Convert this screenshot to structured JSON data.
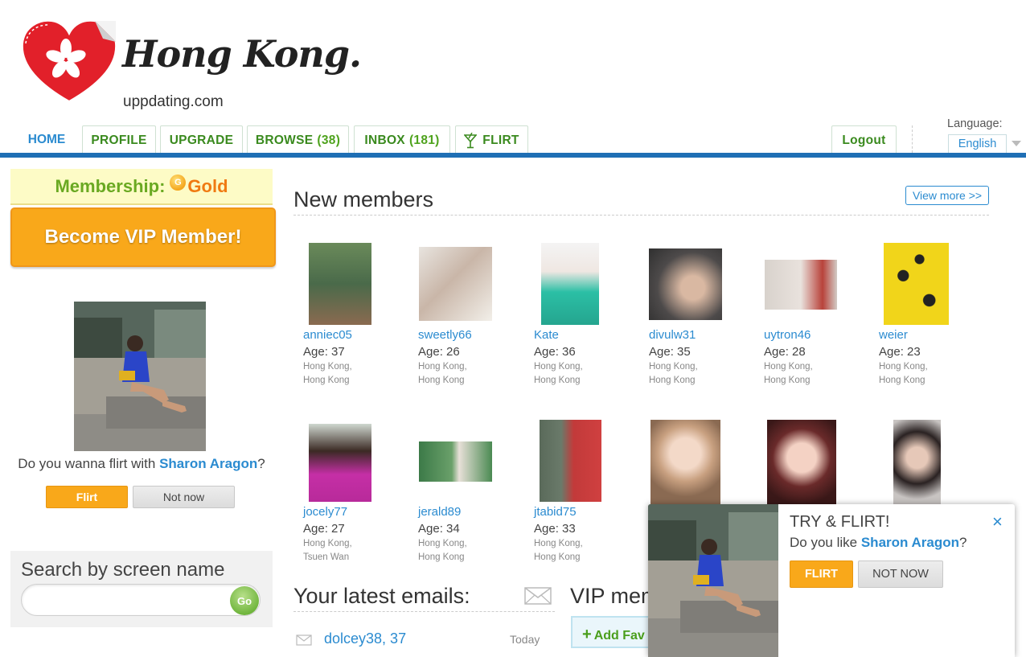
{
  "logo": {
    "title": "Hong Kong.",
    "domain": "uppdating.com",
    "heart_color": "#e2202a"
  },
  "nav": {
    "home": "HOME",
    "tabs": [
      {
        "label": "PROFILE",
        "count": ""
      },
      {
        "label": "UPGRADE",
        "count": ""
      },
      {
        "label": "BROWSE",
        "count": "(38)"
      },
      {
        "label": "INBOX",
        "count": "(181)"
      },
      {
        "label": "FLIRT",
        "count": "",
        "icon": "cocktail-icon"
      }
    ],
    "logout": "Logout",
    "language_label": "Language:",
    "language_value": "English",
    "accent": "#1f6fb5"
  },
  "sidebar": {
    "membership_label": "Membership:",
    "membership_level": "Gold",
    "vip_button": "Become VIP Member!",
    "flirt_prompt_pre": "Do you wanna flirt with",
    "flirt_name": "Sharon Aragon",
    "flirt_prompt_post": "?",
    "flirt_button": "Flirt",
    "not_now_button": "Not now",
    "search_title": "Search by screen name",
    "search_value": "",
    "go_button": "Go"
  },
  "new_members": {
    "title": "New members",
    "view_more": "View more >>",
    "members": [
      {
        "name": "anniec05",
        "age": "Age: 37",
        "city": "Hong Kong,",
        "region": "Hong Kong"
      },
      {
        "name": "sweetly66",
        "age": "Age: 26",
        "city": "Hong Kong,",
        "region": "Hong Kong"
      },
      {
        "name": "Kate",
        "age": "Age: 36",
        "city": "Hong Kong,",
        "region": "Hong Kong"
      },
      {
        "name": "divulw31",
        "age": "Age: 35",
        "city": "Hong Kong,",
        "region": "Hong Kong"
      },
      {
        "name": "uytron46",
        "age": "Age: 28",
        "city": "Hong Kong,",
        "region": "Hong Kong"
      },
      {
        "name": "weier",
        "age": "Age: 23",
        "city": "Hong Kong,",
        "region": "Hong Kong"
      },
      {
        "name": "jocely77",
        "age": "Age: 27",
        "city": "Hong Kong,",
        "region": "Tsuen Wan"
      },
      {
        "name": "jerald89",
        "age": "Age: 34",
        "city": "Hong Kong,",
        "region": "Hong Kong"
      },
      {
        "name": "jtabid75",
        "age": "Age: 33",
        "city": "Hong Kong,",
        "region": "Hong Kong"
      }
    ]
  },
  "emails": {
    "title": "Your latest emails:",
    "rows": [
      {
        "sender": "dolcey38, 37",
        "date": "Today"
      }
    ]
  },
  "vip": {
    "title": "VIP mem",
    "add_button": "Add Fav"
  },
  "popup": {
    "title": "TRY & FLIRT!",
    "question_pre": "Do you like",
    "name": "Sharon Aragon",
    "question_post": "?",
    "flirt_button": "FLIRT",
    "not_now_button": "NOT NOW",
    "close": "×"
  }
}
